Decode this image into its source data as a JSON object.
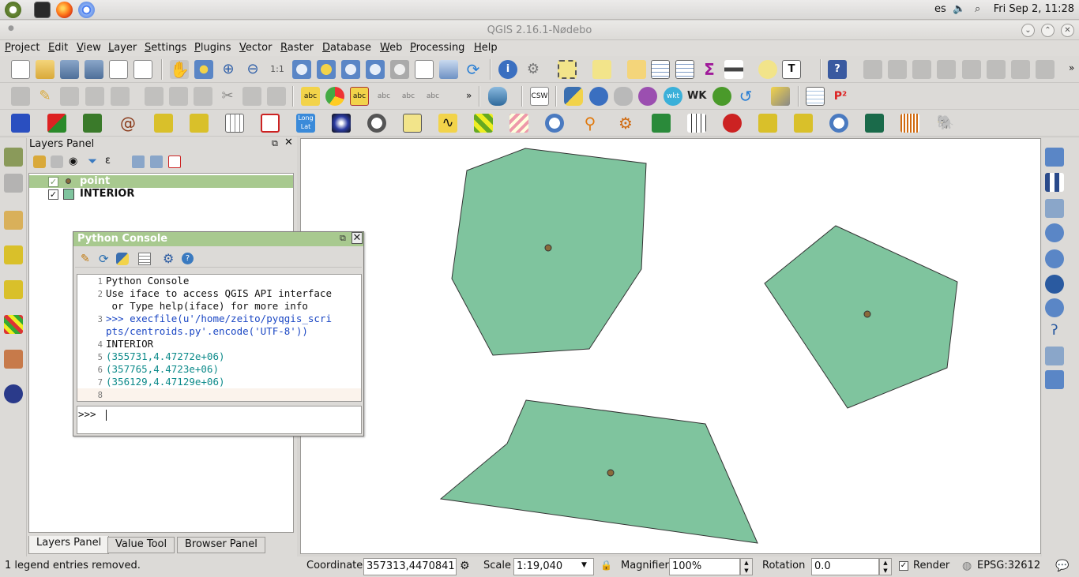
{
  "os_panel": {
    "language": "es",
    "clock": "Fri Sep  2, 11:28"
  },
  "window": {
    "title": "QGIS 2.16.1-Nødebo"
  },
  "menu": [
    "Project",
    "Edit",
    "View",
    "Layer",
    "Settings",
    "Plugins",
    "Vector",
    "Raster",
    "Database",
    "Web",
    "Processing",
    "Help"
  ],
  "layers_panel": {
    "title": "Layers Panel",
    "layers": [
      {
        "name": "point",
        "checked": true,
        "selected": true,
        "symbol": "point-symbol"
      },
      {
        "name": "INTERIOR",
        "checked": true,
        "selected": false,
        "symbol": "polygon-symbol"
      }
    ],
    "tabs": [
      "Layers Panel",
      "Value Tool",
      "Browser Panel"
    ],
    "active_tab": "Layers Panel"
  },
  "python_console": {
    "title": "Python Console",
    "lines": [
      {
        "n": "1",
        "text": "Python Console"
      },
      {
        "n": "2",
        "text": "Use iface to access QGIS API interface"
      },
      {
        "n": "",
        "text": " or Type help(iface) for more info"
      },
      {
        "n": "3",
        "text": ">>> execfile(u'/home/zeito/pyqgis_scri"
      },
      {
        "n": "",
        "text": "pts/centroids.py'.encode('UTF-8'))"
      },
      {
        "n": "4",
        "text": "INTERIOR"
      },
      {
        "n": "5",
        "text": "(355731,4.47272e+06)"
      },
      {
        "n": "6",
        "text": "(357765,4.4723e+06)"
      },
      {
        "n": "7",
        "text": "(356129,4.47129e+06)"
      },
      {
        "n": "8",
        "text": ""
      }
    ],
    "prompt": ">>>"
  },
  "status_bar": {
    "message": "1 legend entries removed.",
    "coordinate_label": "Coordinate",
    "coordinate_value": "357313,4470841",
    "scale_label": "Scale",
    "scale_value": "1:19,040",
    "magnifier_label": "Magnifier",
    "magnifier_value": "100%",
    "rotation_label": "Rotation",
    "rotation_value": "0.0",
    "render_label": "Render",
    "render_checked": true,
    "crs": "EPSG:32612"
  },
  "map_style": {
    "polygon_fill": "#7fc49e",
    "polygon_stroke": "#333333",
    "point_fill": "#8a6a3a"
  },
  "colors": {
    "console_title": "#a8c98f",
    "selected_layer": "#a8c98f"
  }
}
